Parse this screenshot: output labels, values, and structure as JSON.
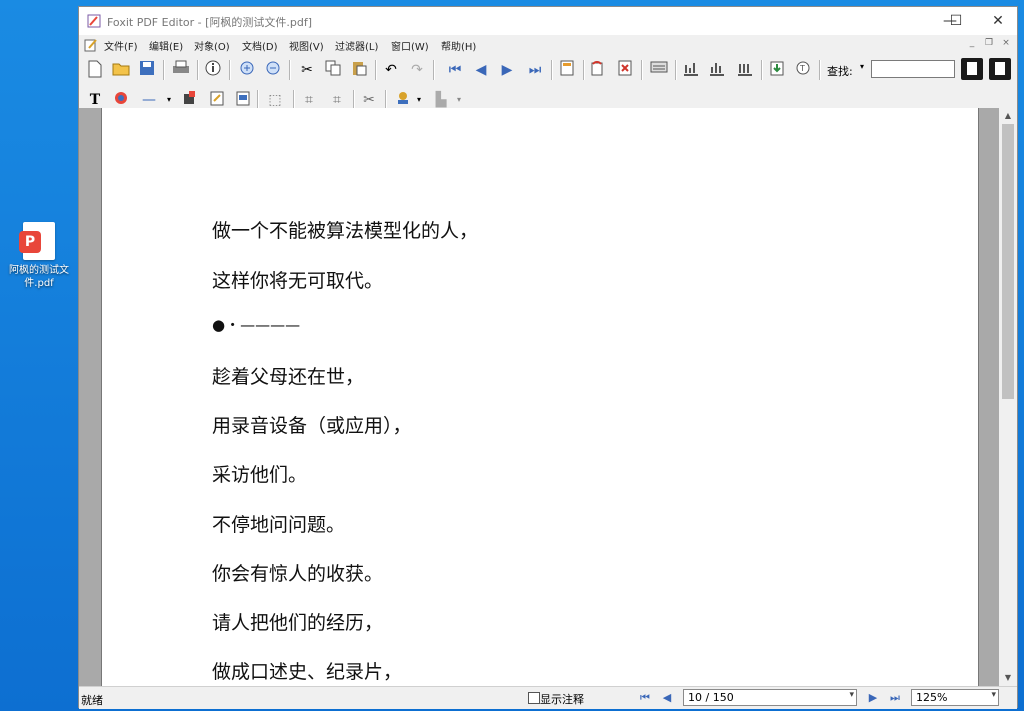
{
  "desktop": {
    "file_icon_label": "阿枫的测试文件.pdf"
  },
  "window": {
    "title": "Foxit PDF Editor - [阿枫的测试文件.pdf]",
    "controls": {
      "minimize": "—",
      "maximize": "☐",
      "close": "✕"
    }
  },
  "menu": {
    "items": [
      "文件(F)",
      "编辑(E)",
      "对象(O)",
      "文档(D)",
      "视图(V)",
      "过滤器(L)",
      "窗口(W)",
      "帮助(H)"
    ],
    "mdi": {
      "minimize": "_",
      "restore": "❐",
      "close": "×"
    }
  },
  "toolbar": {
    "find_label": "查找:",
    "find_value": ""
  },
  "document": {
    "lines": [
      "做一个不能被算法模型化的人，",
      "这样你将无可取代。",
      "●・————",
      "趁着父母还在世，",
      "用录音设备（或应用），",
      "采访他们。",
      "不停地问问题。",
      "你会有惊人的收获。",
      "请人把他们的经历，",
      "做成口述史、纪录片，"
    ]
  },
  "statusbar": {
    "status": "就绪",
    "show_annotations": "显示注释",
    "page": "10 / 150",
    "zoom": "125%"
  },
  "colors": {
    "desktop": "#1a8be3",
    "window_bg": "#f0f0f0",
    "doc_bg": "#a9a9a9",
    "accent_red": "#e8463a",
    "nav_blue": "#3a67b8"
  }
}
